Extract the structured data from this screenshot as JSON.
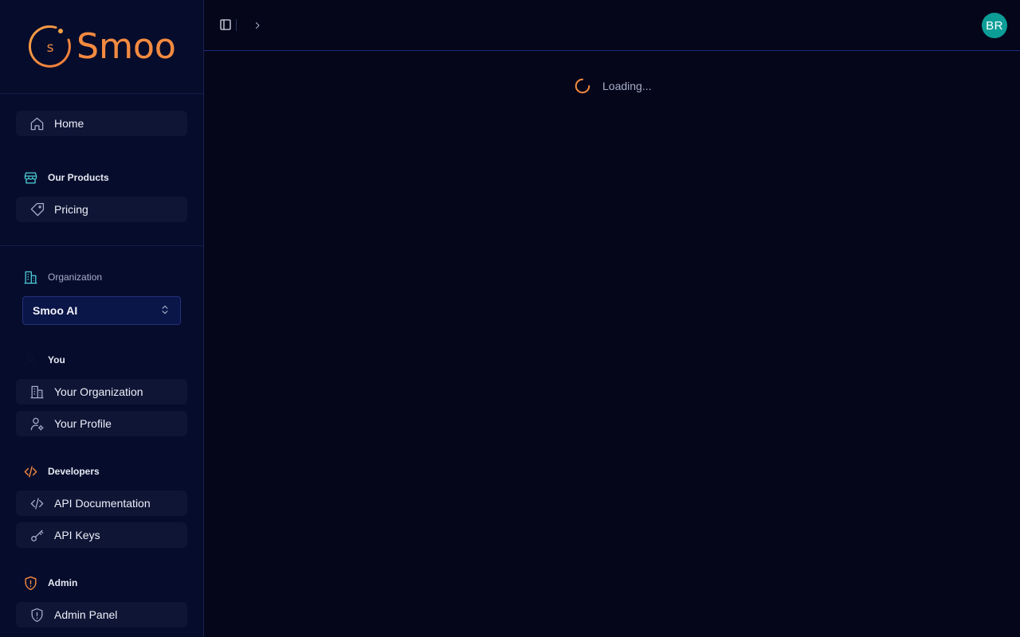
{
  "app": {
    "logo_text": "Smoo",
    "logo_mark_letter": "s"
  },
  "sidebar": {
    "home": {
      "label": "Home",
      "icon": "home-icon"
    },
    "products_section": {
      "title": "Our Products",
      "icon": "store-icon"
    },
    "pricing": {
      "label": "Pricing",
      "icon": "tag-icon"
    },
    "organization_section": {
      "title": "Organization",
      "icon": "building-icon"
    },
    "organization_select": {
      "value": "Smoo AI",
      "icon": "chevrons-up-down-icon"
    },
    "you_section": {
      "title": "You",
      "icon": "user-icon"
    },
    "your_organization": {
      "label": "Your Organization",
      "icon": "building-icon"
    },
    "your_profile": {
      "label": "Your Profile",
      "icon": "user-cog-icon"
    },
    "developers_section": {
      "title": "Developers",
      "icon": "code-icon"
    },
    "api_documentation": {
      "label": "API Documentation",
      "icon": "code-icon"
    },
    "api_keys": {
      "label": "API Keys",
      "icon": "key-icon"
    },
    "admin_section": {
      "title": "Admin",
      "icon": "shield-alert-icon"
    },
    "admin_panel": {
      "label": "Admin Panel",
      "icon": "shield-icon"
    }
  },
  "header": {
    "avatar_initials": "BR",
    "toggle_icon": "panel-left-icon",
    "breadcrumb_icon": "chevron-right-icon"
  },
  "main": {
    "loading_text": "Loading..."
  },
  "colors": {
    "accent": "#f38a40",
    "teal": "#4fd1d9",
    "avatar": "#0d9d97",
    "background": "#05061a",
    "sidebar": "#060c2c"
  }
}
